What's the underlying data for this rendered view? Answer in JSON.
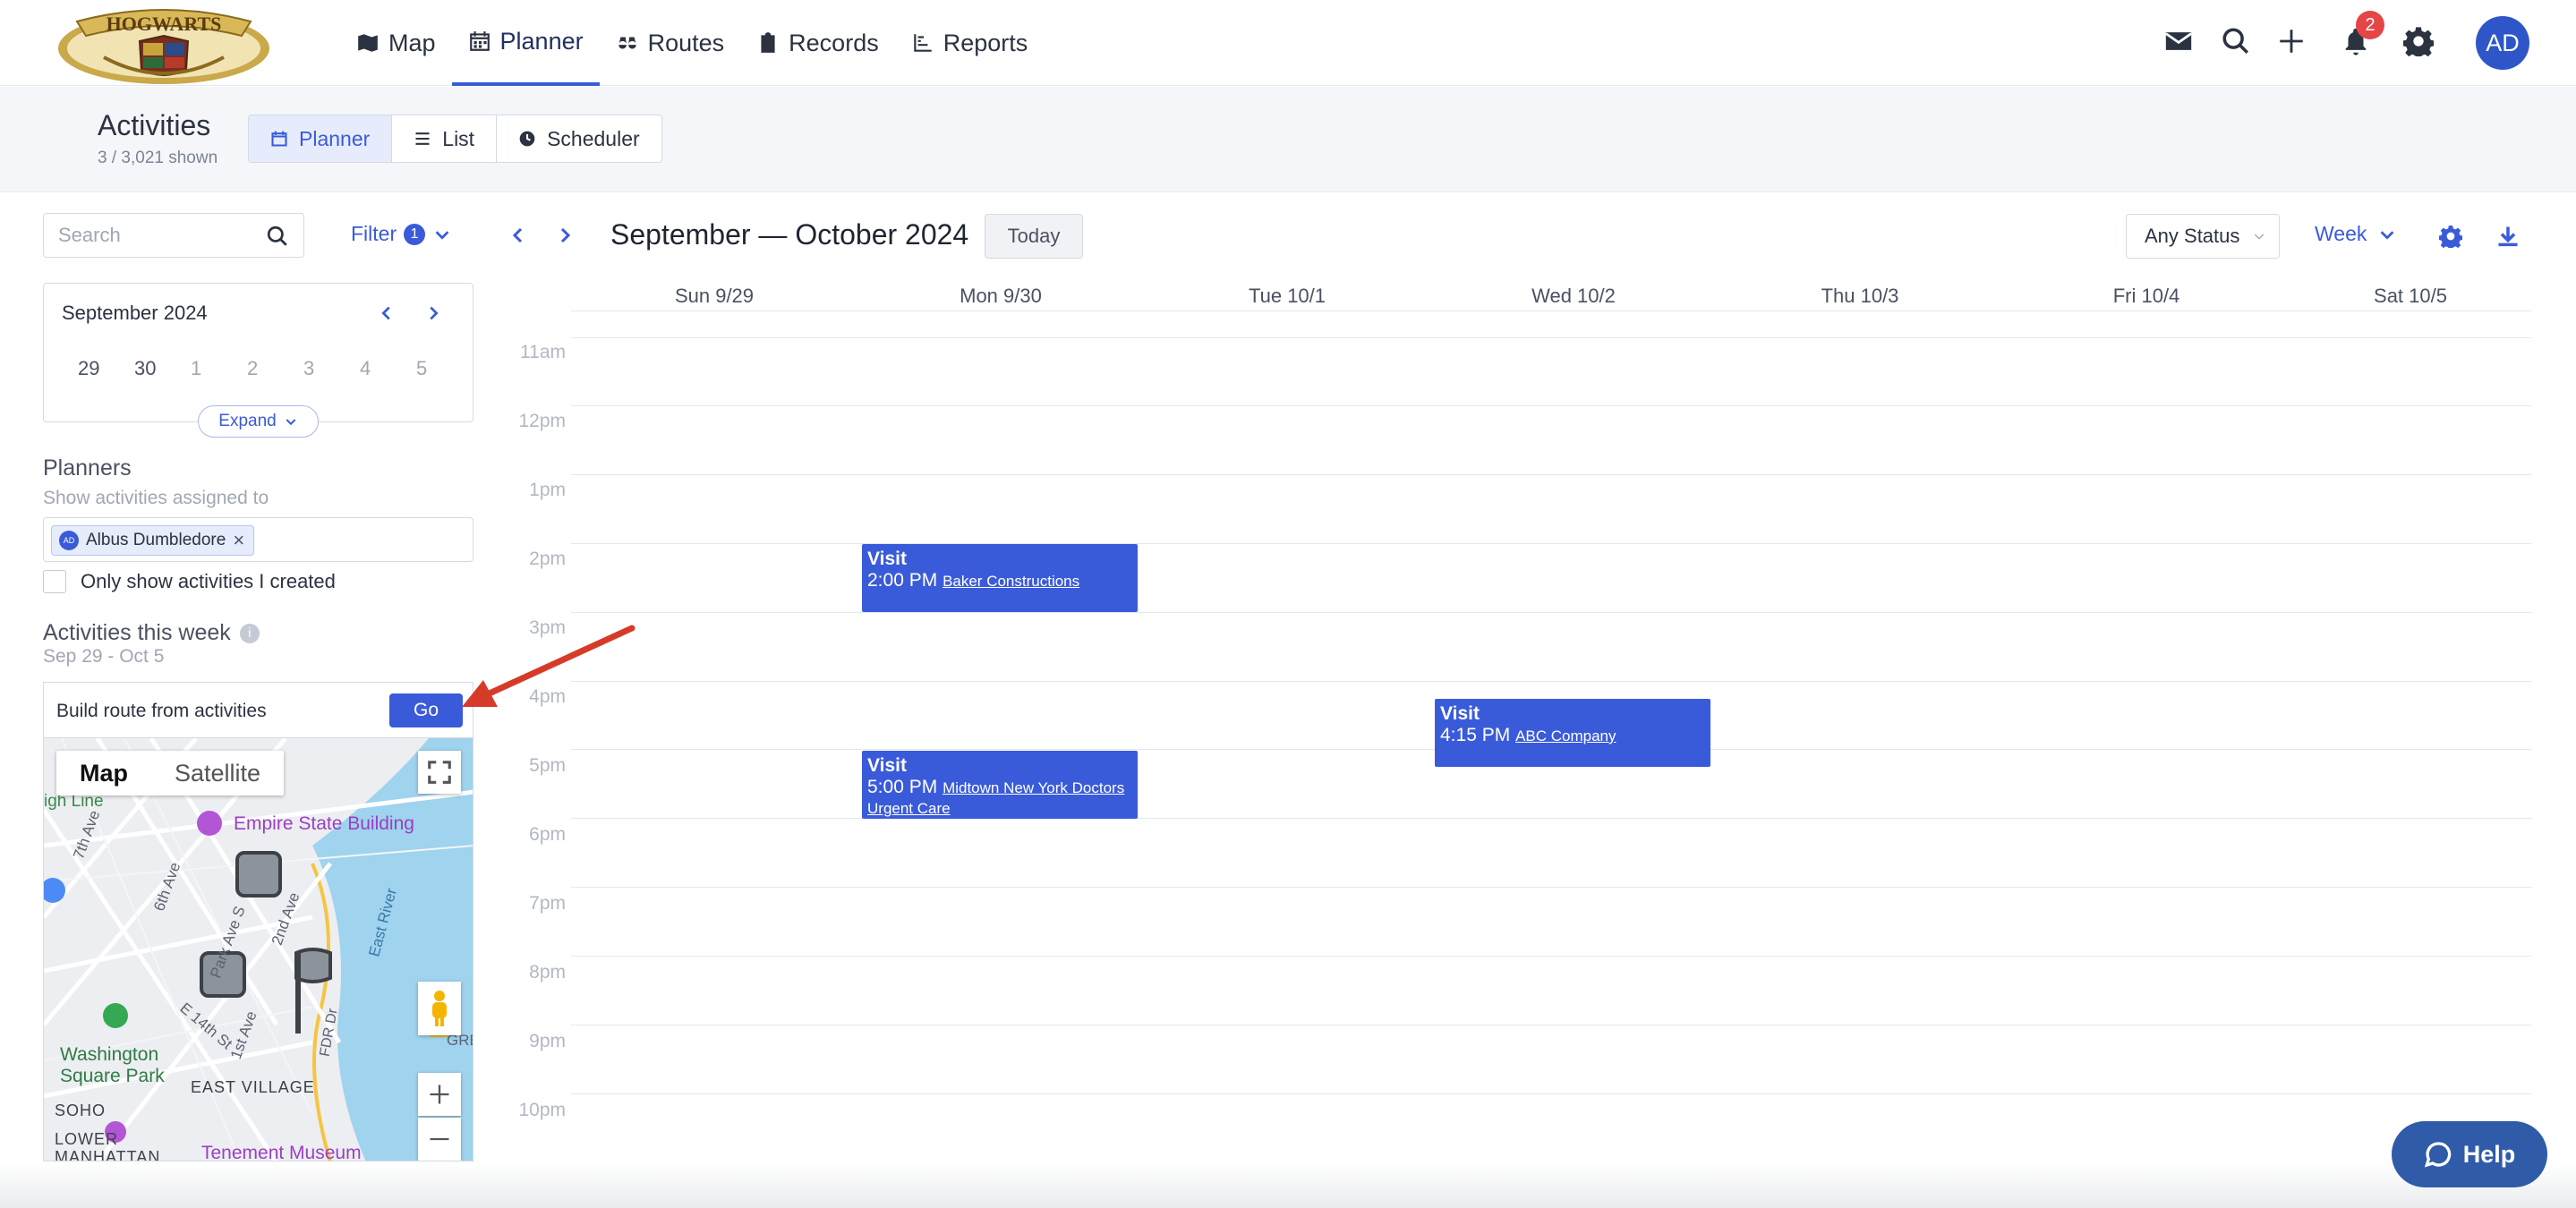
{
  "nav": {
    "logo_text": "HOGWARTS",
    "links": [
      {
        "label": "Map",
        "icon": "map-icon"
      },
      {
        "label": "Planner",
        "icon": "calendar-icon"
      },
      {
        "label": "Routes",
        "icon": "binoculars-icon"
      },
      {
        "label": "Records",
        "icon": "clipboard-icon"
      },
      {
        "label": "Reports",
        "icon": "chart-icon"
      }
    ],
    "active_link": "Planner",
    "notification_count": "2",
    "user_initials": "AD"
  },
  "header": {
    "title": "Activities",
    "count": "3 / 3,021 shown",
    "views": [
      "Planner",
      "List",
      "Scheduler"
    ],
    "active_view": "Planner"
  },
  "sidebar": {
    "search_placeholder": "Search",
    "filter_label": "Filter",
    "filter_count": "1",
    "mini_calendar": {
      "month": "September 2024",
      "days": [
        "29",
        "30",
        "1",
        "2",
        "3",
        "4",
        "5"
      ],
      "expand_label": "Expand"
    },
    "planners_label": "Planners",
    "planners_sub": "Show activities assigned to",
    "planner_chip": {
      "initials": "AD",
      "name": "Albus Dumbledore"
    },
    "only_mine_label": "Only show activities I created",
    "week_label": "Activities this week",
    "week_range": "Sep 29 - Oct 5",
    "route_text": "Build route from activities",
    "go_label": "Go",
    "map": {
      "types": [
        "Map",
        "Satellite"
      ],
      "active_type": "Map",
      "labels": [
        "Empire State Building",
        "Washington Square Park",
        "EAST VILLAGE",
        "SOHO",
        "LOWER MANHATTAN",
        "Tenement Museum",
        "East River",
        "FDR Dr",
        "7th Ave",
        "6th Ave",
        "Park Ave S",
        "2nd Ave",
        "1st Ave",
        "E 14th St",
        "igh Line",
        "GRE"
      ]
    }
  },
  "calendar": {
    "title": "September — October 2024",
    "today_label": "Today",
    "status_filter": "Any Status",
    "view_mode": "Week",
    "days": [
      "Sun 9/29",
      "Mon 9/30",
      "Tue 10/1",
      "Wed 10/2",
      "Thu 10/3",
      "Fri 10/4",
      "Sat 10/5"
    ],
    "hours": [
      "11am",
      "12pm",
      "1pm",
      "2pm",
      "3pm",
      "4pm",
      "5pm",
      "6pm",
      "7pm",
      "8pm",
      "9pm",
      "10pm"
    ],
    "events": [
      {
        "type": "Visit",
        "time": "2:00 PM",
        "company": "Baker Constructions",
        "day": "Mon 9/30"
      },
      {
        "type": "Visit",
        "time": "4:15 PM",
        "company": "ABC Company",
        "day": "Wed 10/2"
      },
      {
        "type": "Visit",
        "time": "5:00 PM",
        "company": "Midtown New York Doctors Urgent Care",
        "day": "Mon 9/30"
      }
    ]
  },
  "help_label": "Help",
  "colors": {
    "accent": "#3a5bd9",
    "event": "#3a5bd9",
    "badge": "#e54545",
    "annotation_arrow": "#d63b2a",
    "help": "#2f5ba8"
  }
}
